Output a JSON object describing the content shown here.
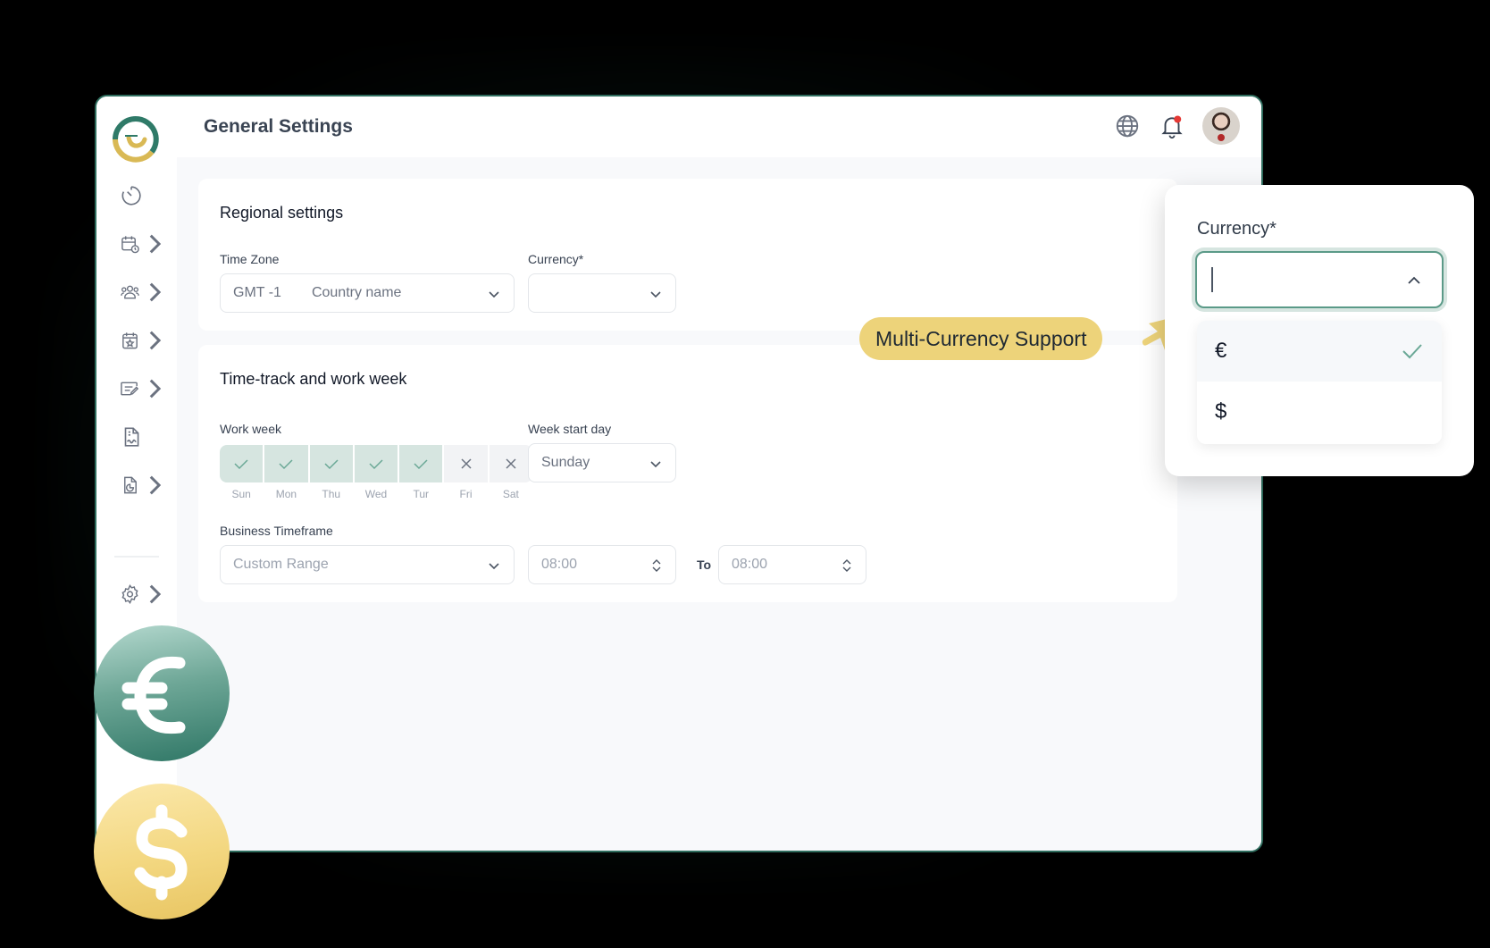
{
  "header": {
    "title": "General Settings",
    "icons": [
      "globe-icon",
      "bell-icon",
      "avatar"
    ],
    "notification_dot_color": "#e53935"
  },
  "sidebar": {
    "items": [
      {
        "icon": "timer-icon",
        "has_submenu": false
      },
      {
        "icon": "calendar-clock-icon",
        "has_submenu": true
      },
      {
        "icon": "team-icon",
        "has_submenu": true
      },
      {
        "icon": "calendar-star-icon",
        "has_submenu": true
      },
      {
        "icon": "edit-list-icon",
        "has_submenu": true
      },
      {
        "icon": "document-signature-icon",
        "has_submenu": false
      },
      {
        "icon": "report-pie-icon",
        "has_submenu": true
      },
      {
        "icon": "gear-icon",
        "has_submenu": true
      }
    ]
  },
  "regional": {
    "title": "Regional settings",
    "timezone_label": "Time Zone",
    "timezone_offset": "GMT -1",
    "timezone_country": "Country name",
    "currency_label": "Currency*",
    "currency_value": ""
  },
  "timetrack": {
    "title": "Time-track and work week",
    "workweek_label": "Work week",
    "days": [
      {
        "label": "Sun",
        "enabled": true
      },
      {
        "label": "Mon",
        "enabled": true
      },
      {
        "label": "Thu",
        "enabled": true
      },
      {
        "label": "Wed",
        "enabled": true
      },
      {
        "label": "Tur",
        "enabled": true
      },
      {
        "label": "Fri",
        "enabled": false
      },
      {
        "label": "Sat",
        "enabled": false
      }
    ],
    "week_start_label": "Week start day",
    "week_start_value": "Sunday",
    "business_label": "Business Timeframe",
    "business_range": "Custom Range",
    "from_time": "08:00",
    "to_label": "To",
    "to_time": "08:00"
  },
  "callout": {
    "text": "Multi-Currency Support",
    "color": "#edd37a"
  },
  "currency_popup": {
    "label": "Currency*",
    "input_value": "",
    "options": [
      {
        "symbol": "€",
        "selected": true
      },
      {
        "symbol": "$",
        "selected": false
      }
    ]
  },
  "decorations": {
    "coins": [
      {
        "symbol": "euro",
        "color": "#4a8d7b"
      },
      {
        "symbol": "dollar",
        "color": "#f0d27a"
      }
    ]
  },
  "colors": {
    "brand_green": "#2f7a68",
    "brand_gold": "#d9b955",
    "check_green": "#6aa896"
  }
}
